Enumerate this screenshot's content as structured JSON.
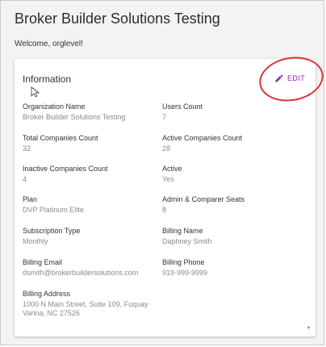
{
  "page": {
    "title": "Broker Builder Solutions Testing",
    "welcome": "Welcome, orglevel!"
  },
  "card": {
    "title": "Information",
    "edit_label": "EDIT",
    "edit_icon": "pencil-icon",
    "accent_color": "#8e24aa"
  },
  "fields": {
    "org_name": {
      "label": "Organization Name",
      "value": "Broker Builder Solutions Testing"
    },
    "users_count": {
      "label": "Users Count",
      "value": "7"
    },
    "total_companies": {
      "label": "Total Companies Count",
      "value": "32"
    },
    "active_companies": {
      "label": "Active Companies Count",
      "value": "28"
    },
    "inactive_companies": {
      "label": "Inactive Companies Count",
      "value": "4"
    },
    "active": {
      "label": "Active",
      "value": "Yes"
    },
    "plan": {
      "label": "Plan",
      "value": "DVP Platinum Elite"
    },
    "seats": {
      "label": "Admin & Comparer Seats",
      "value": "8"
    },
    "subscription": {
      "label": "Subscription Type",
      "value": "Monthly"
    },
    "billing_name": {
      "label": "Billing Name",
      "value": "Daphney Smith"
    },
    "billing_email": {
      "label": "Billing Email",
      "value": "dsmith@brokerbuildersolutions.com"
    },
    "billing_phone": {
      "label": "Billing Phone",
      "value": "919-999-9999"
    },
    "billing_address": {
      "label": "Billing Address",
      "value": "1000 N Main Street, Suite 109, Fuquay Varina, NC 27526"
    }
  }
}
